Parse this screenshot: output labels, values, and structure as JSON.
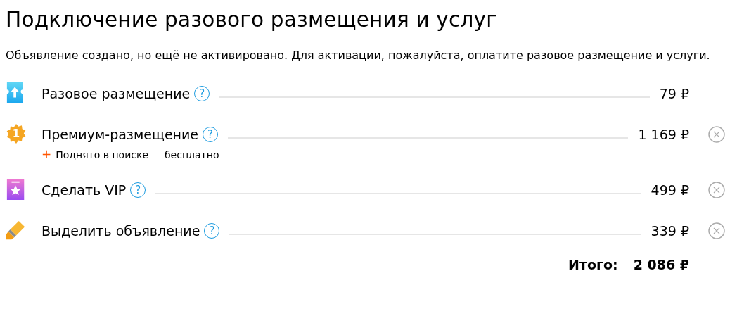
{
  "title": "Подключение разового размещения и услуг",
  "notice": "Объявление создано, но ещё не активировано. Для активации, пожалуйста, оплатите разовое размещение и услуги.",
  "services": [
    {
      "kind": "raise",
      "name": "Разовое размещение",
      "help": "?",
      "price": "79 ₽",
      "removable": false
    },
    {
      "kind": "premium",
      "icon_text": "1",
      "name": "Премиум-размещение",
      "help": "?",
      "price": "1 169 ₽",
      "removable": true,
      "perk": {
        "mark": "+",
        "text": "Поднято в поиске — бесплатно"
      }
    },
    {
      "kind": "vip",
      "name": "Сделать VIP",
      "help": "?",
      "price": "499 ₽",
      "removable": true
    },
    {
      "kind": "highlight",
      "name": "Выделить объявление",
      "help": "?",
      "price": "339 ₽",
      "removable": true
    }
  ],
  "total": {
    "label": "Итого:",
    "value": "2 086 ₽"
  }
}
